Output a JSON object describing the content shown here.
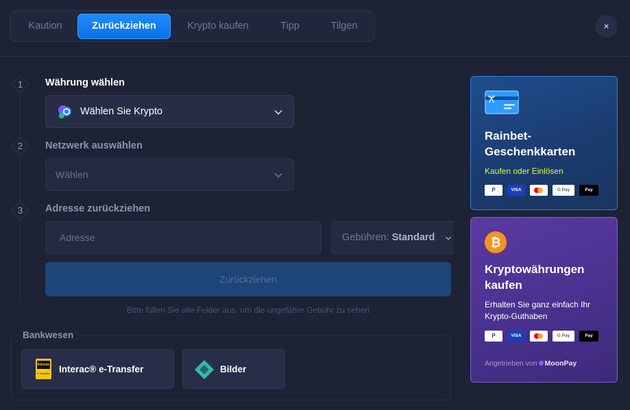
{
  "tabs": [
    {
      "label": "Kaution"
    },
    {
      "label": "Zurückziehen"
    },
    {
      "label": "Krypto kaufen"
    },
    {
      "label": "Tipp"
    },
    {
      "label": "Tilgen"
    }
  ],
  "active_tab": "Zurückziehen",
  "close_label": "×",
  "steps": [
    {
      "number": "1",
      "label": "Währung wählen"
    },
    {
      "number": "2",
      "label": "Netzwerk auswählen"
    },
    {
      "number": "3",
      "label": "Adresse zurückziehen"
    }
  ],
  "currency_select": {
    "value": "Wählen Sie Krypto"
  },
  "network_select": {
    "value": "Wählen"
  },
  "address_input": {
    "placeholder": "Adresse"
  },
  "fees": {
    "label": "Gebühren:",
    "value": "Standard"
  },
  "submit_label": "Zurückziehen",
  "hint": "Bitte füllen Sie alle Felder aus, um die ungefähre Gebühr zu sehen",
  "banking": {
    "title": "Bankwesen",
    "methods": [
      {
        "label": "Interac® e-Transfer",
        "icon": "interac-icon",
        "logo_top": "Interac",
        "logo_bottom": "e-Transfer"
      },
      {
        "label": "Bilder",
        "icon": "bilder-icon"
      }
    ]
  },
  "gift_card": {
    "title_line1": "Rainbet-",
    "title_line2": "Geschenkkarten",
    "subtitle": "Kaufen oder Einlösen",
    "icon": "gift-card-icon"
  },
  "crypto_buy": {
    "title_line1": "Kryptowährungen",
    "title_line2": "kaufen",
    "subtitle_line1": "Erhalten Sie ganz einfach Ihr",
    "subtitle_line2": "Krypto-Guthaben",
    "powered_by": "Angetrieben von",
    "provider": "MoonPay",
    "icon": "bitcoin-icon"
  },
  "payment_methods": [
    {
      "label": "P",
      "icon": "paypal-icon"
    },
    {
      "label": "VISA",
      "icon": "visa-icon"
    },
    {
      "label": "",
      "icon": "mastercard-icon"
    },
    {
      "label": "G Pay",
      "icon": "google-pay-icon"
    },
    {
      "label": "Pay",
      "icon": "apple-pay-icon"
    }
  ],
  "colors": {
    "accent": "#1f8cff",
    "background": "#1d2235",
    "gift_accent": "#d4ff3c",
    "bitcoin": "#f7931a"
  }
}
